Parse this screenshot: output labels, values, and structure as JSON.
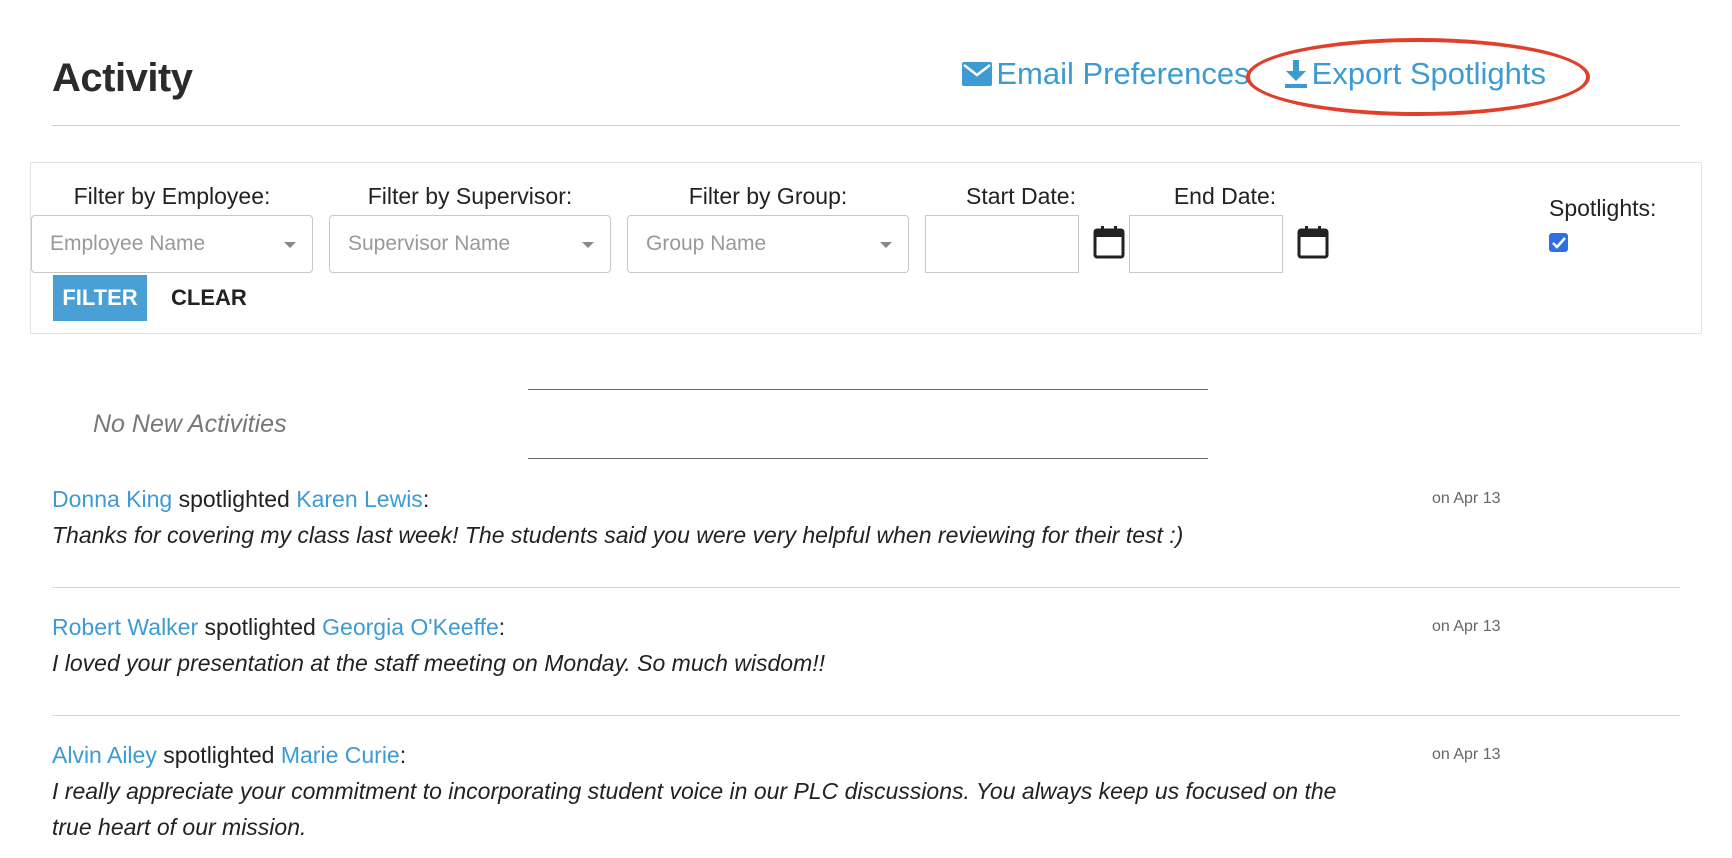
{
  "header": {
    "title": "Activity",
    "email_preferences": "Email Preferences",
    "export_spotlights": "Export Spotlights"
  },
  "filters": {
    "employee_label": "Filter by Employee:",
    "employee_placeholder": "Employee Name",
    "supervisor_label": "Filter by Supervisor:",
    "supervisor_placeholder": "Supervisor Name",
    "group_label": "Filter by Group:",
    "group_placeholder": "Group Name",
    "start_date_label": "Start Date:",
    "end_date_label": "End Date:",
    "spotlights_label": "Spotlights:",
    "spotlights_checked": true,
    "filter_button": "FILTER",
    "clear_button": "CLEAR"
  },
  "empty_state": "No New Activities",
  "activities": [
    {
      "from": "Donna King",
      "verb": "spotlighted",
      "to": "Karen Lewis",
      "message": "Thanks for covering my class last week! The students said you were very helpful when reviewing for their test :)",
      "date": "on Apr 13"
    },
    {
      "from": "Robert Walker",
      "verb": "spotlighted",
      "to": "Georgia O'Keeffe",
      "message": "I loved your presentation at the staff meeting on Monday. So much wisdom!!",
      "date": "on Apr 13"
    },
    {
      "from": "Alvin Ailey",
      "verb": "spotlighted",
      "to": "Marie Curie",
      "message": "I really appreciate your commitment to incorporating student voice in our PLC discussions. You always keep us focused on the true heart of our mission.",
      "date": "on Apr 13"
    }
  ],
  "colors": {
    "link": "#3d9bd4",
    "highlight": "#e0402a",
    "filter_button": "#4aa0d5"
  }
}
